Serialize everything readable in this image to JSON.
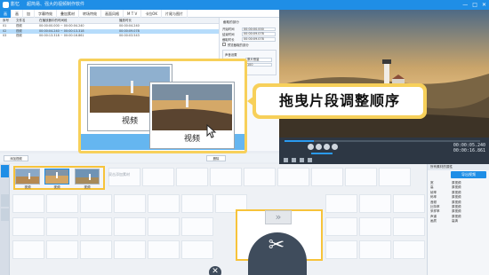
{
  "app": {
    "name": "影忆",
    "slogan": "超简易、强大的视频制作软件",
    "window_controls": [
      "—",
      "□",
      "✕"
    ]
  },
  "menu": [
    "画",
    "画",
    "加",
    "字幕特效",
    "叠加素材",
    "转场特效",
    "画面风格",
    "M T V",
    "卡拉OK",
    "片尾与图片"
  ],
  "subtitle_list": {
    "headers": [
      "序号",
      "文件名",
      "在播放器中的时间段",
      "播放时长"
    ],
    "rows": [
      {
        "no": "01",
        "name": "视频",
        "range": "00:00:00.000 ~ 00:00:04.240",
        "dur": "00:00:04.240",
        "selected": false
      },
      {
        "no": "02",
        "name": "视频",
        "range": "00:00:04.240 ~ 00:00:13.318",
        "dur": "00:00:09.078",
        "selected": true
      },
      {
        "no": "03",
        "name": "视频",
        "range": "00:00:13.318 ~ 00:00:16.861",
        "dur": "00:00:03.543",
        "selected": false
      }
    ]
  },
  "props": {
    "title": "截取的部分",
    "fields": [
      {
        "label": "开始时间",
        "value": "00:00:00.000"
      },
      {
        "label": "结束时间",
        "value": "00:00:09.078"
      },
      {
        "label": "截取时长",
        "value": "00:00:09.078"
      }
    ],
    "check1": "预览截取的部分",
    "group_title": "声音设置",
    "group_fields": [
      {
        "label": "音量",
        "value": "原片音量"
      },
      {
        "label": "音量",
        "value": "100"
      }
    ],
    "check2": "静音",
    "confirm_button": "确认修改"
  },
  "buttons": {
    "add": "添加视频",
    "remove": "删除"
  },
  "popup": {
    "card_label_1": "视频",
    "card_label_2": "视频"
  },
  "callout": {
    "text": "拖曳片段调整顺序"
  },
  "player": {
    "time_current": "00:00:05.240",
    "time_total": "00:00:16.861",
    "seek_progress": 0.15
  },
  "timeline": {
    "hint": "双击添加素材",
    "thumb_labels": [
      "视频",
      "视频",
      "视频"
    ]
  },
  "info_panel": {
    "title": "所有素材的属性",
    "export_button": "导出视频",
    "rows": [
      {
        "k": "宽",
        "v": "原视频"
      },
      {
        "k": "高",
        "v": "原视频"
      },
      {
        "k": "帧率",
        "v": "原视频"
      },
      {
        "k": "码率",
        "v": "原视频"
      },
      {
        "k": "音频",
        "v": "原视频"
      },
      {
        "k": "比特率",
        "v": "原视频"
      },
      {
        "k": "采样率",
        "v": "原视频"
      },
      {
        "k": "声道",
        "v": "原视频"
      },
      {
        "k": "画质",
        "v": "高清"
      }
    ]
  },
  "colors": {
    "accent": "#1f8ee6",
    "highlight": "#f7d05a",
    "popup_bar": "#65b6f0"
  }
}
